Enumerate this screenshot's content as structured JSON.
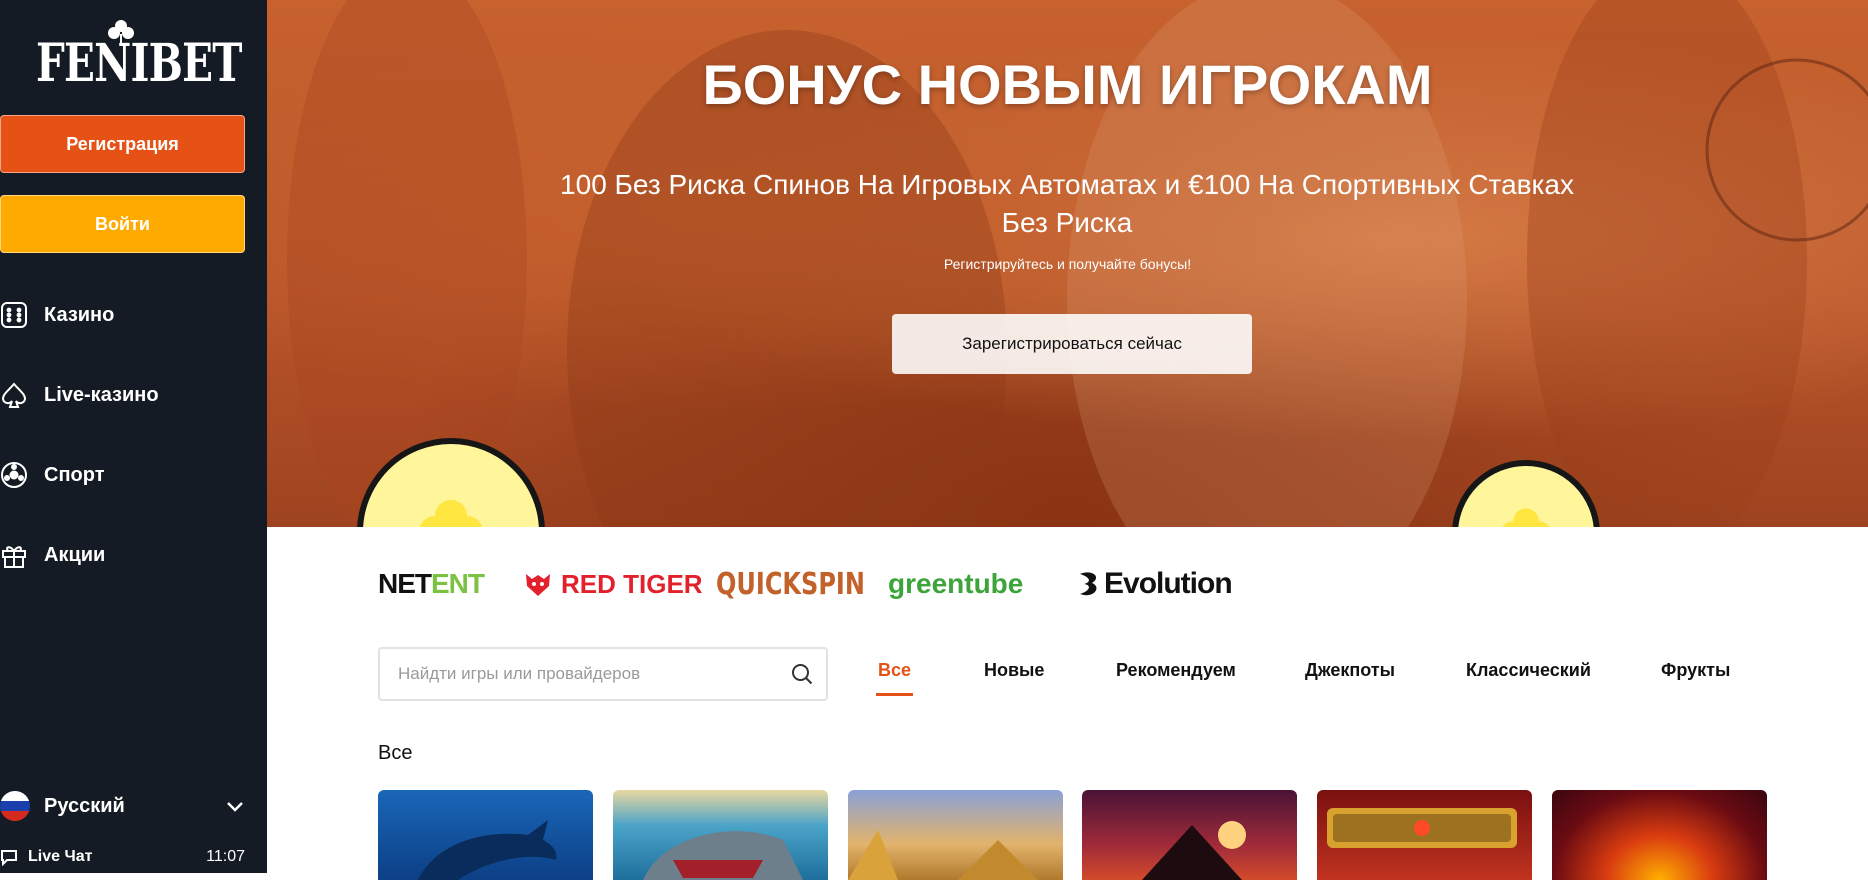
{
  "sidebar": {
    "logo": "FENIBET",
    "register_label": "Регистрация",
    "login_label": "Войти",
    "nav": [
      {
        "label": "Казино",
        "icon": "dice-icon"
      },
      {
        "label": "Live-казино",
        "icon": "spade-icon"
      },
      {
        "label": "Спорт",
        "icon": "football-icon"
      },
      {
        "label": "Акции",
        "icon": "gift-icon"
      }
    ],
    "language": "Русский",
    "live_chat": "Live Чат",
    "time": "11:07"
  },
  "hero": {
    "title": "БОНУС НОВЫМ ИГРОКАМ",
    "subtitle": "100 Без Риска Спинов На Игровых Автоматах и €100 На Спортивных Ставках Без Риска",
    "small": "Регистрируйтесь и получайте бонусы!",
    "cta": "Зарегистрироваться сейчас"
  },
  "providers": {
    "netent_a": "NET",
    "netent_b": "ENT",
    "redtiger": "RED TIGER",
    "quickspin": "QUICKSPIN",
    "greentube": "greentube",
    "evolution": "Evolution"
  },
  "search": {
    "placeholder": "Найдти игры или провайдеров"
  },
  "tabs": [
    "Все",
    "Новые",
    "Рекомендуем",
    "Джекпоты",
    "Классический",
    "Фрукты"
  ],
  "section_title": "Все",
  "colors": {
    "sidebar": "#141b24",
    "accent": "#e65115",
    "login": "#ffaa00"
  }
}
